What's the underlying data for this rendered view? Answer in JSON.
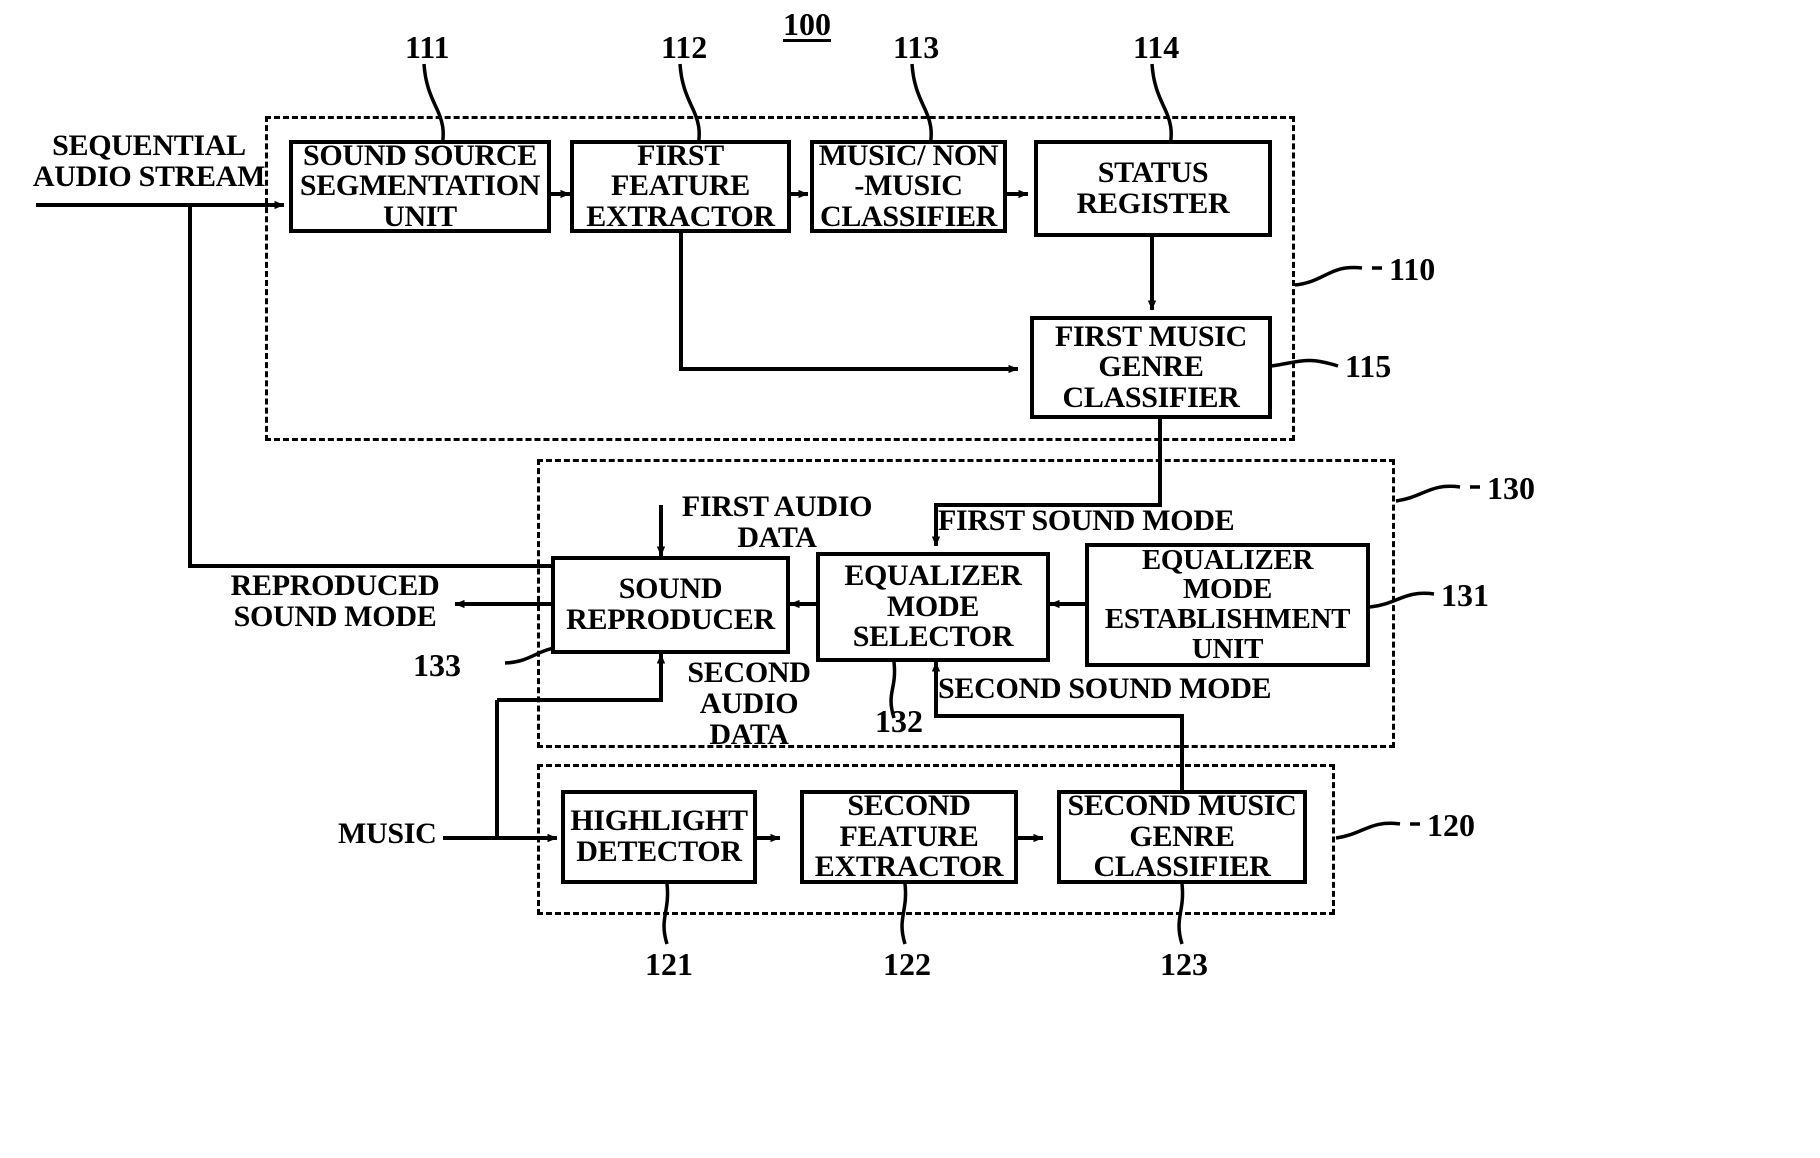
{
  "figure": {
    "title": "100",
    "external_labels": {
      "input_stream": "SEQUENTIAL\nAUDIO STREAM",
      "reproduced_sound_mode": "REPRODUCED\nSOUND MODE",
      "music": "MUSIC",
      "first_audio_data": "FIRST AUDIO\nDATA",
      "second_audio_data": "SECOND\nAUDIO\nDATA",
      "first_sound_mode": "FIRST SOUND MODE",
      "second_sound_mode": "SECOND SOUND MODE"
    },
    "groups": [
      {
        "id": "110",
        "ref": "110"
      },
      {
        "id": "130",
        "ref": "130"
      },
      {
        "id": "120",
        "ref": "120"
      }
    ],
    "blocks": [
      {
        "ref": "111",
        "label": "SOUND SOURCE\nSEGMENTATION\nUNIT"
      },
      {
        "ref": "112",
        "label": "FIRST\nFEATURE\nEXTRACTOR"
      },
      {
        "ref": "113",
        "label": "MUSIC/ NON\n-MUSIC\nCLASSIFIER"
      },
      {
        "ref": "114",
        "label": "STATUS\nREGISTER"
      },
      {
        "ref": "115",
        "label": "FIRST MUSIC\nGENRE\nCLASSIFIER"
      },
      {
        "ref": "133",
        "label": "SOUND\nREPRODUCER"
      },
      {
        "ref": "132",
        "label": "EQUALIZER\nMODE\nSELECTOR"
      },
      {
        "ref": "131",
        "label": "EQUALIZER\nMODE\nESTABLISHMENT\nUNIT"
      },
      {
        "ref": "121",
        "label": "HIGHLIGHT\nDETECTOR"
      },
      {
        "ref": "122",
        "label": "SECOND\nFEATURE\nEXTRACTOR"
      },
      {
        "ref": "123",
        "label": "SECOND MUSIC\nGENRE\nCLASSIFIER"
      }
    ],
    "colors": {
      "ink": "#000000",
      "paper": "#ffffff"
    }
  }
}
